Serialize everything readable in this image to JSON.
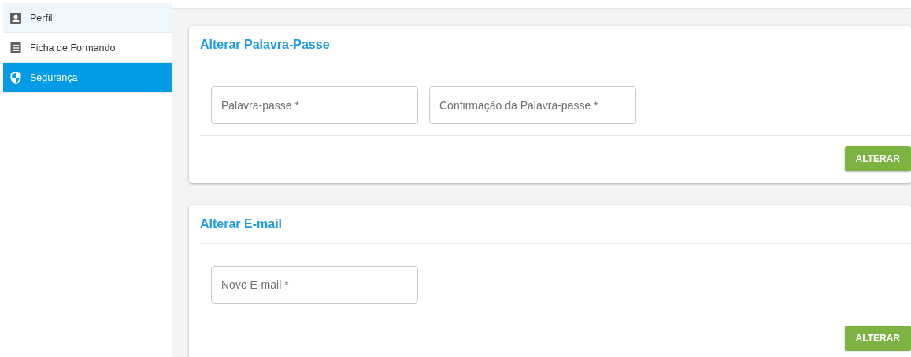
{
  "sidebar": {
    "items": [
      {
        "label": "Perfil",
        "selected": false,
        "highlighted": true
      },
      {
        "label": "Ficha de Formando",
        "selected": false,
        "highlighted": false
      },
      {
        "label": "Segurança",
        "selected": true,
        "highlighted": false
      }
    ]
  },
  "cards": [
    {
      "title": "Alterar Palavra-Passe",
      "fields": [
        {
          "placeholder": "Palavra-passe *"
        },
        {
          "placeholder": "Confirmação da Palavra-passe *"
        }
      ],
      "button": "ALTERAR"
    },
    {
      "title": "Alterar E-mail",
      "fields": [
        {
          "placeholder": "Novo E-mail *"
        }
      ],
      "button": "ALTERAR"
    }
  ]
}
